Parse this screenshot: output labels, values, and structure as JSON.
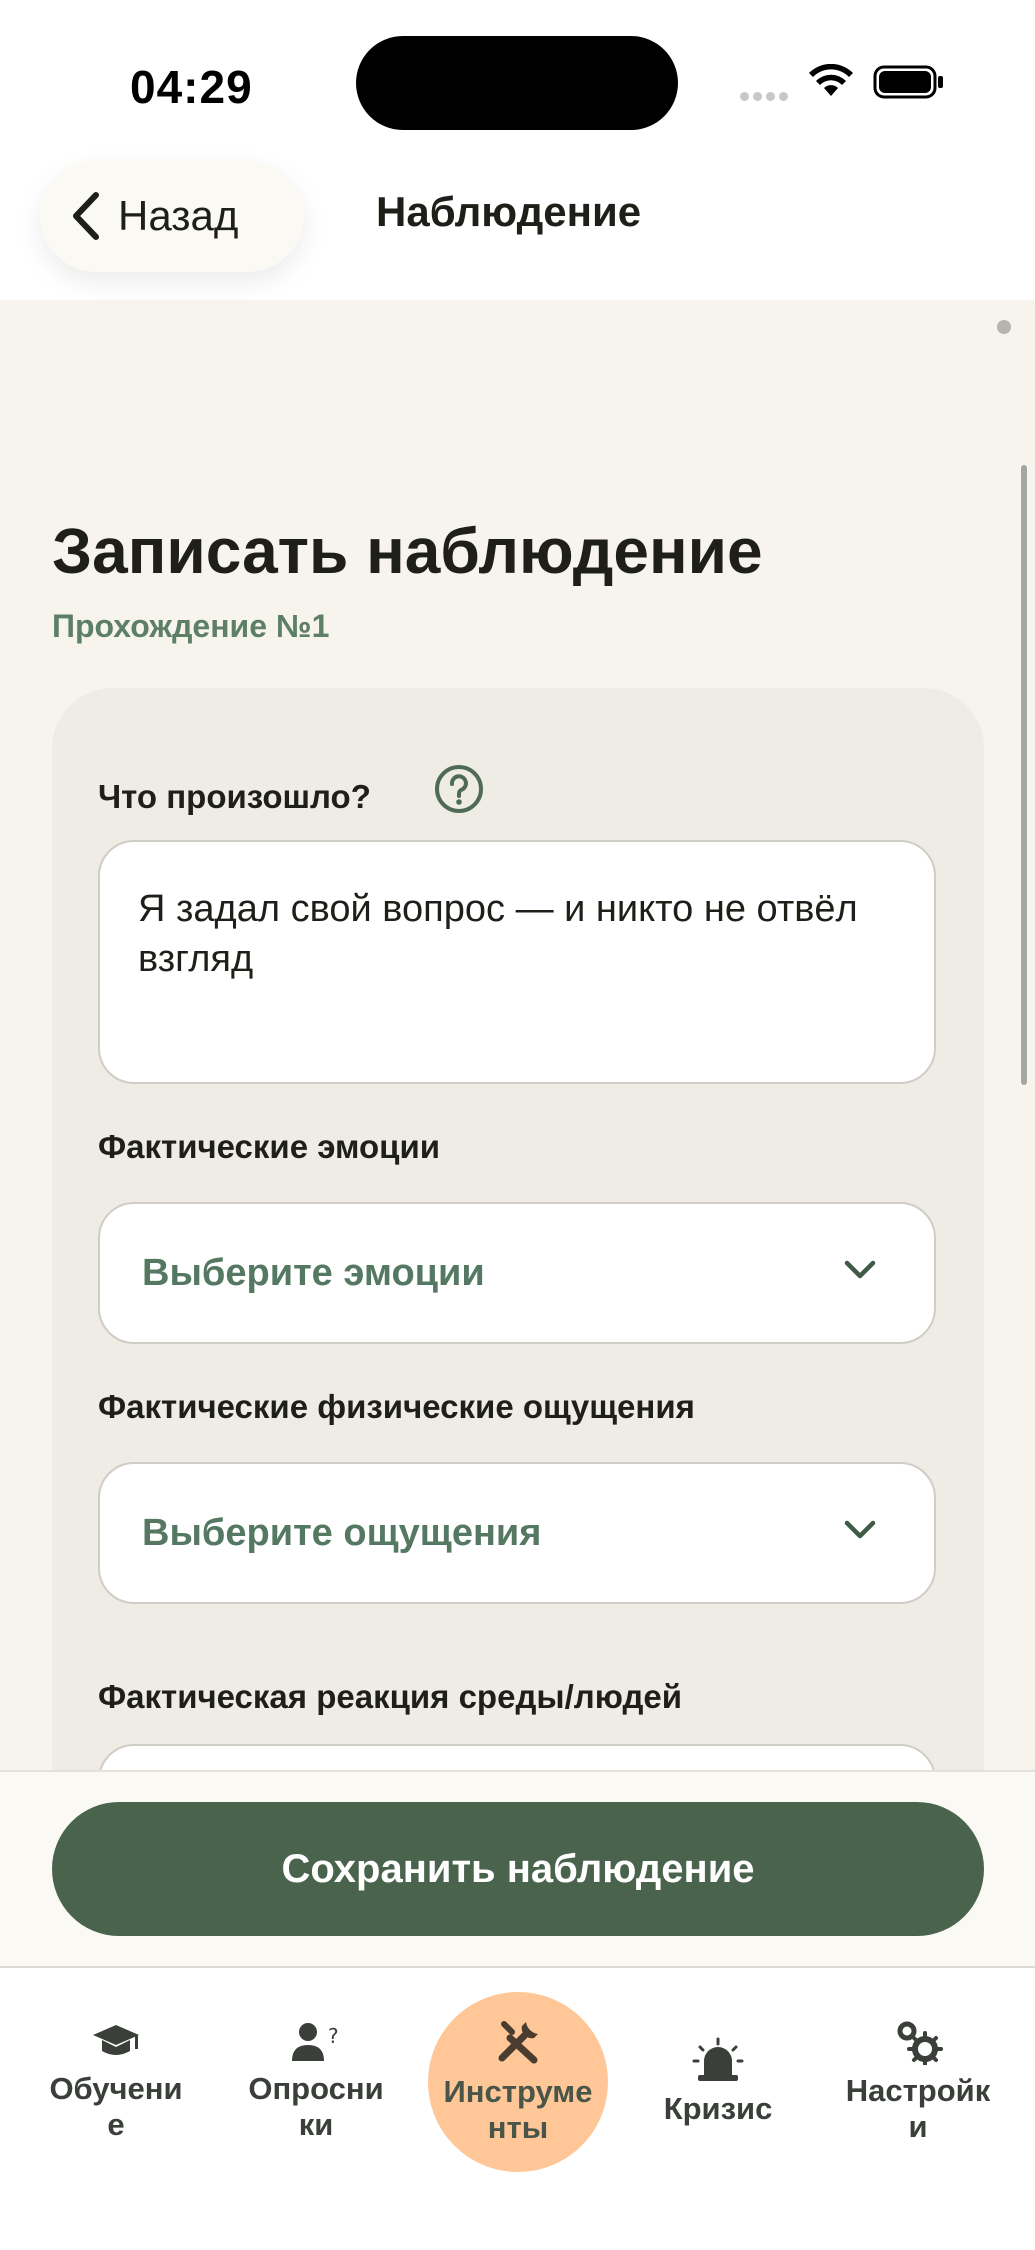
{
  "status_bar": {
    "time": "04:29"
  },
  "header": {
    "back_label": "Назад",
    "title": "Наблюдение"
  },
  "page": {
    "title": "Записать наблюдение",
    "subtitle": "Прохождение №1"
  },
  "form": {
    "what_happened": {
      "label": "Что произошло?",
      "value": "Я задал свой вопрос — и никто не отвёл взгляд"
    },
    "emotions": {
      "label": "Фактические эмоции",
      "placeholder": "Выберите эмоции"
    },
    "sensations": {
      "label": "Фактические физические ощущения",
      "placeholder": "Выберите ощущения"
    },
    "reaction": {
      "label": "Фактическая реакция среды/людей"
    }
  },
  "footer": {
    "save_label": "Сохранить наблюдение"
  },
  "tabs": [
    {
      "label": "Обучение",
      "icon": "graduation-cap-icon",
      "active": false
    },
    {
      "label": "Опросники",
      "icon": "person-question-icon",
      "active": false
    },
    {
      "label": "Инструменты",
      "icon": "tools-icon",
      "active": true
    },
    {
      "label": "Кризис",
      "icon": "siren-icon",
      "active": false
    },
    {
      "label": "Настройки",
      "icon": "gears-icon",
      "active": false
    }
  ],
  "colors": {
    "accent": "#4a634d",
    "subtitle_green": "#5c7f66",
    "active_tab": "#ffc797",
    "background": "#f7f4ee"
  }
}
